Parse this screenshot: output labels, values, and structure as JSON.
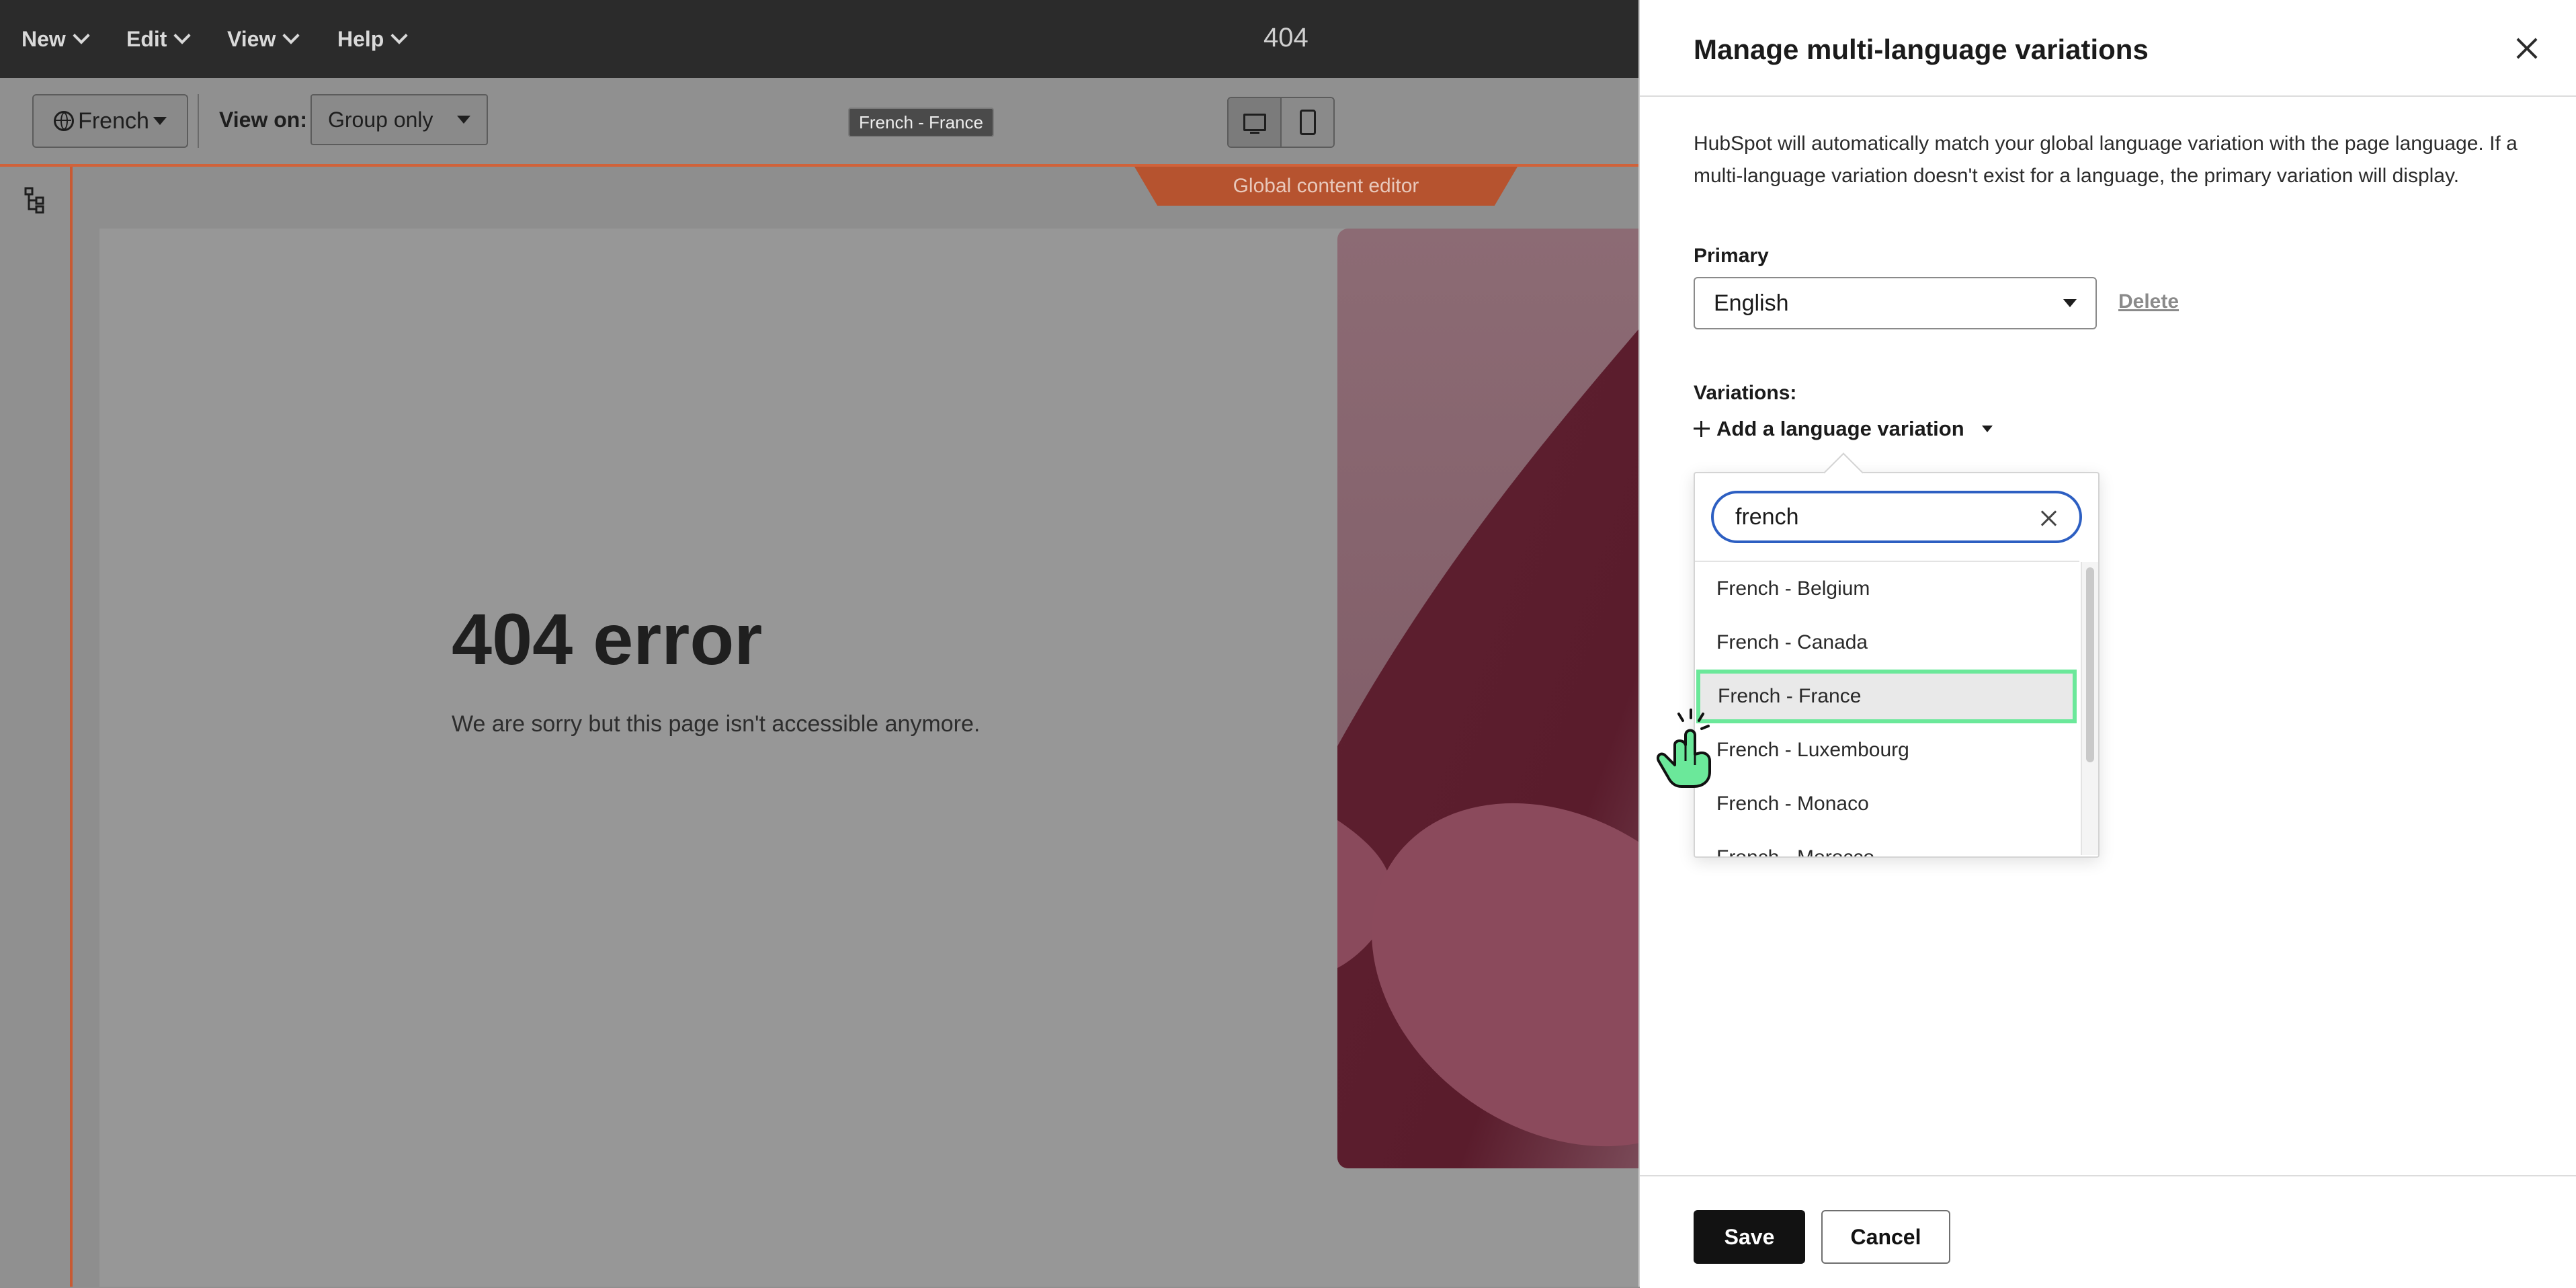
{
  "menubar": {
    "items": [
      {
        "label": "New"
      },
      {
        "label": "Edit"
      },
      {
        "label": "View"
      },
      {
        "label": "Help"
      }
    ],
    "page_title": "404"
  },
  "toolbar": {
    "language_label": "French",
    "view_on_label": "View on:",
    "view_on_value": "Group only",
    "tooltip": "French - France"
  },
  "canvas": {
    "global_content_tab": "Global content editor",
    "error_title": "404 error",
    "error_text": "We are sorry but this page isn't accessible anymore."
  },
  "panel": {
    "title": "Manage multi-language variations",
    "description": "HubSpot will automatically match your global language variation with the page language. If a multi-language variation doesn't exist for a language, the primary variation will display.",
    "primary_label": "Primary",
    "primary_value": "English",
    "delete_label": "Delete",
    "variations_label": "Variations:",
    "add_variation_label": "Add a language variation",
    "search_value": "french",
    "options": [
      {
        "label": "French - Belgium"
      },
      {
        "label": "French - Canada"
      },
      {
        "label": "French - France"
      },
      {
        "label": "French - Luxembourg"
      },
      {
        "label": "French - Monaco"
      },
      {
        "label": "French - Morocco"
      }
    ],
    "save_label": "Save",
    "cancel_label": "Cancel"
  },
  "colors": {
    "accent_orange": "#c85a33",
    "highlight_green": "#6be89a",
    "search_focus_blue": "#2d5fc2"
  }
}
